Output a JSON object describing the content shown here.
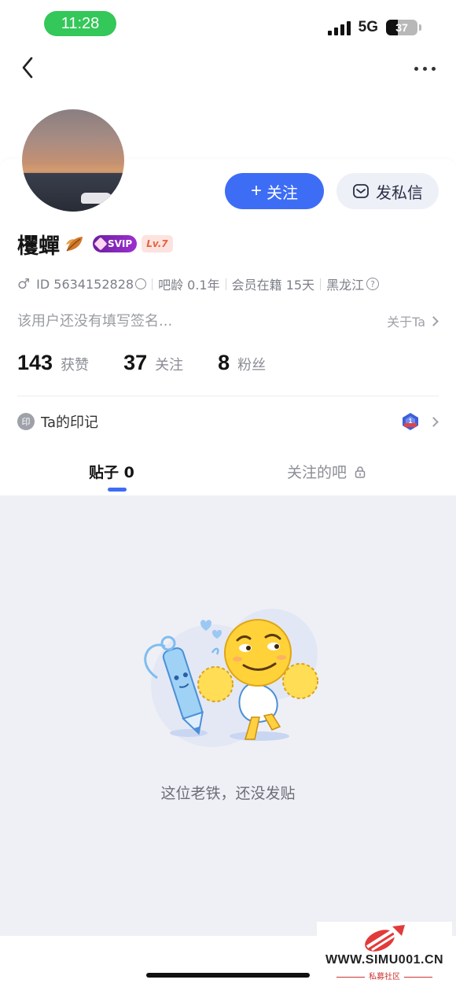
{
  "status_bar": {
    "time": "11:28",
    "network": "5G",
    "battery": "37",
    "battery_level": 0.37
  },
  "profile": {
    "name": "欔蟬",
    "svip_label": "SVIP",
    "level": "Lv.7",
    "follow_button": "关注",
    "message_button": "发私信",
    "id": "ID 5634152828",
    "bar_age": "吧龄 0.1年",
    "membership": "会员在籍 15天",
    "location": "黑龙江",
    "signature": "该用户还没有填写签名...",
    "about_link": "关于Ta"
  },
  "stats": [
    {
      "num": "143",
      "label": "获赞"
    },
    {
      "num": "37",
      "label": "关注"
    },
    {
      "num": "8",
      "label": "粉丝"
    }
  ],
  "marks": {
    "icon_text": "印",
    "label": "Ta的印记"
  },
  "tabs": {
    "posts": "贴子 0",
    "followed_bars": "关注的吧"
  },
  "empty_state": {
    "message": "这位老铁，还没发贴"
  },
  "watermark": {
    "site": "WWW.SIMU001.CN",
    "sub": "私募社区"
  },
  "colors": {
    "accent": "#3e6df5",
    "content_bg": "#eff0f5",
    "status_green": "#34c759"
  }
}
